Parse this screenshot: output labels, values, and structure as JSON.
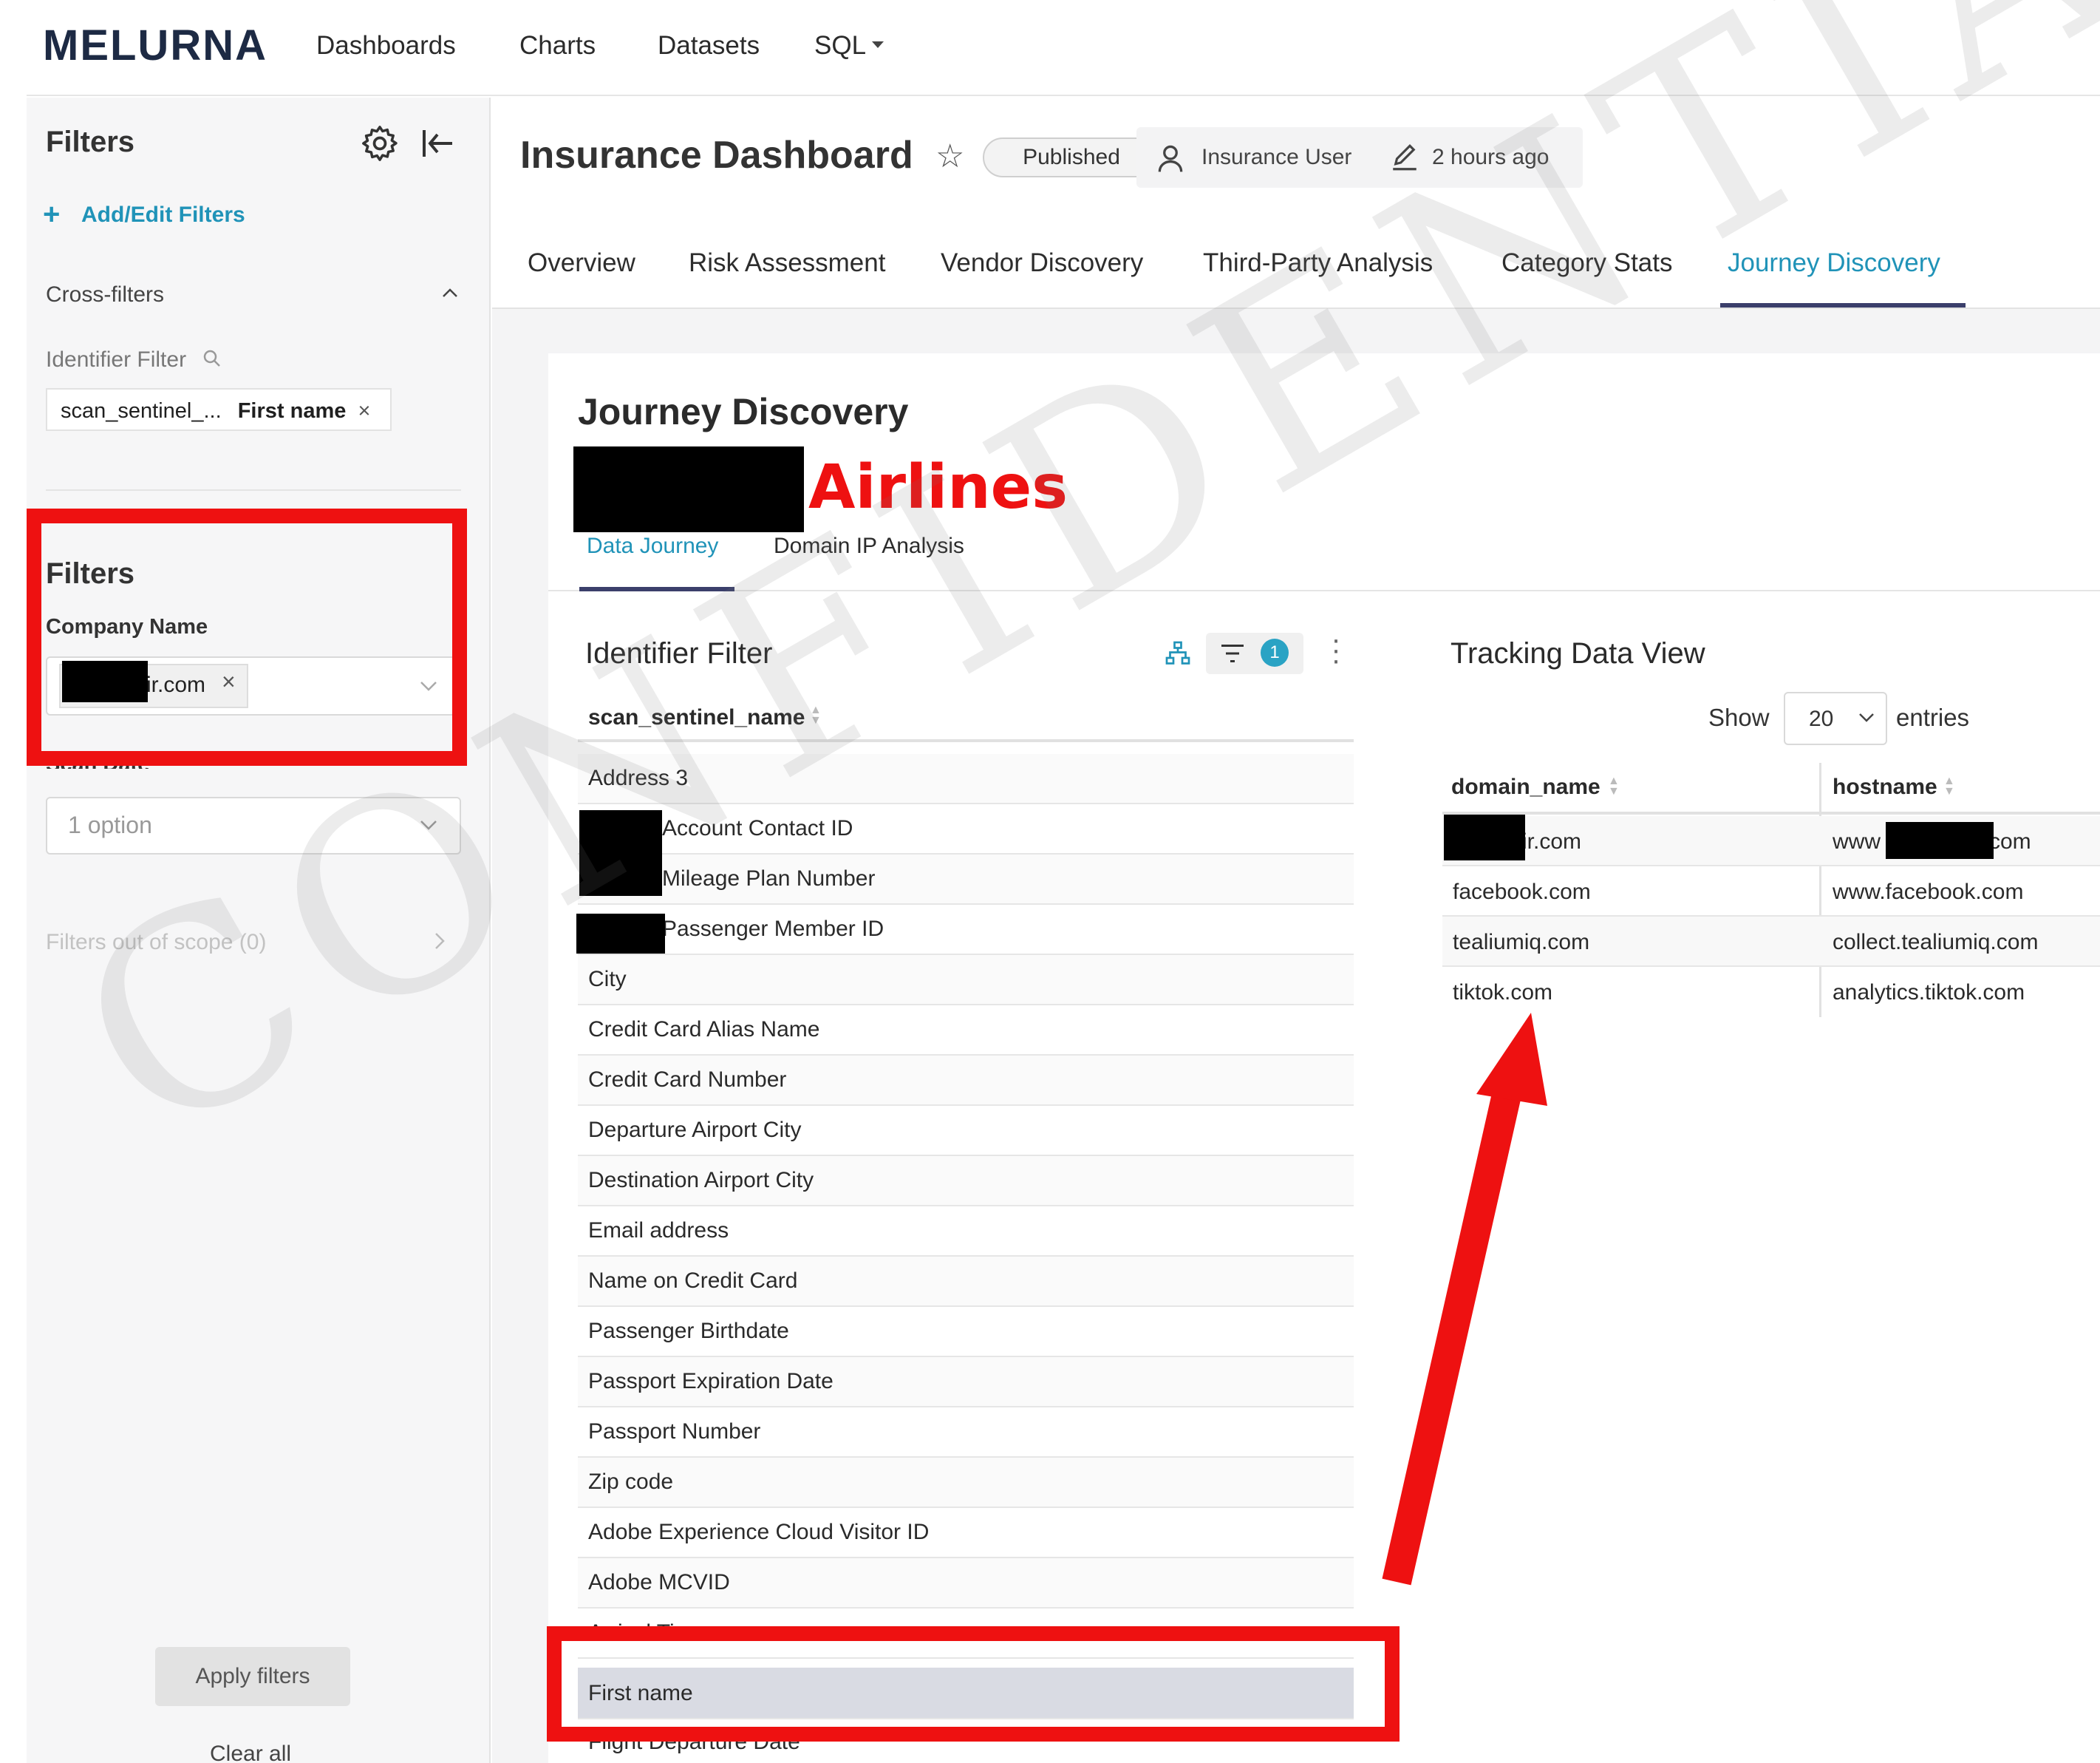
{
  "app": {
    "logo": "MELURNA",
    "nav": [
      "Dashboards",
      "Charts",
      "Datasets",
      "SQL"
    ]
  },
  "sidebar": {
    "title": "Filters",
    "add_edit": "Add/Edit Filters",
    "cross_filters": "Cross-filters",
    "identifier_filter": "Identifier Filter",
    "chip_left": "scan_sentinel_...",
    "chip_right": "First name",
    "filters_heading": "Filters",
    "company_name_label": "Company Name",
    "company_value": "ir.com",
    "scan_date_label": "Scan Date",
    "scan_date_placeholder": "1 option",
    "out_of_scope": "Filters out of scope (0)",
    "apply": "Apply filters",
    "clear": "Clear all"
  },
  "header": {
    "title": "Insurance Dashboard",
    "status": "Published",
    "owner": "Insurance User",
    "modified": "2 hours ago"
  },
  "tabs": [
    "Overview",
    "Risk Assessment",
    "Vendor Discovery",
    "Third-Party Analysis",
    "Category Stats",
    "Journey Discovery"
  ],
  "active_tab": "Journey Discovery",
  "panel": {
    "title": "Journey Discovery",
    "company_suffix": "Airlines",
    "subtabs": [
      "Data Journey",
      "Domain IP Analysis"
    ]
  },
  "identifier_table": {
    "title": "Identifier Filter",
    "filter_count": "1",
    "column": "scan_sentinel_name",
    "rows": [
      "Address 3",
      "Account Contact ID",
      "Mileage Plan Number",
      "Passenger Member ID",
      "City",
      "Credit Card Alias Name",
      "Credit Card Number",
      "Departure Airport City",
      "Destination Airport City",
      "Email address",
      "Name on Credit Card",
      "Passenger Birthdate",
      "Passport Expiration Date",
      "Passport Number",
      "Zip code",
      "Adobe Experience Cloud Visitor ID",
      "Adobe MCVID",
      "Arrival Time",
      "First name",
      "Flight Departure Date"
    ],
    "selected": "First name"
  },
  "tracking_table": {
    "title": "Tracking Data View",
    "show_label": "Show",
    "page_size": "20",
    "entries_label": "entries",
    "columns": [
      "domain_name",
      "hostname"
    ],
    "rows": [
      [
        "ir.com",
        "www",
        "com"
      ],
      [
        "facebook.com",
        "www.facebook.com"
      ],
      [
        "tealiumiq.com",
        "collect.tealiumiq.com"
      ],
      [
        "tiktok.com",
        "analytics.tiktok.com"
      ]
    ]
  },
  "watermark": "CONFIDENTIAL",
  "colors": {
    "accent": "#2093b8",
    "annotation_red": "#ee1111",
    "logo": "#1d2a44"
  }
}
